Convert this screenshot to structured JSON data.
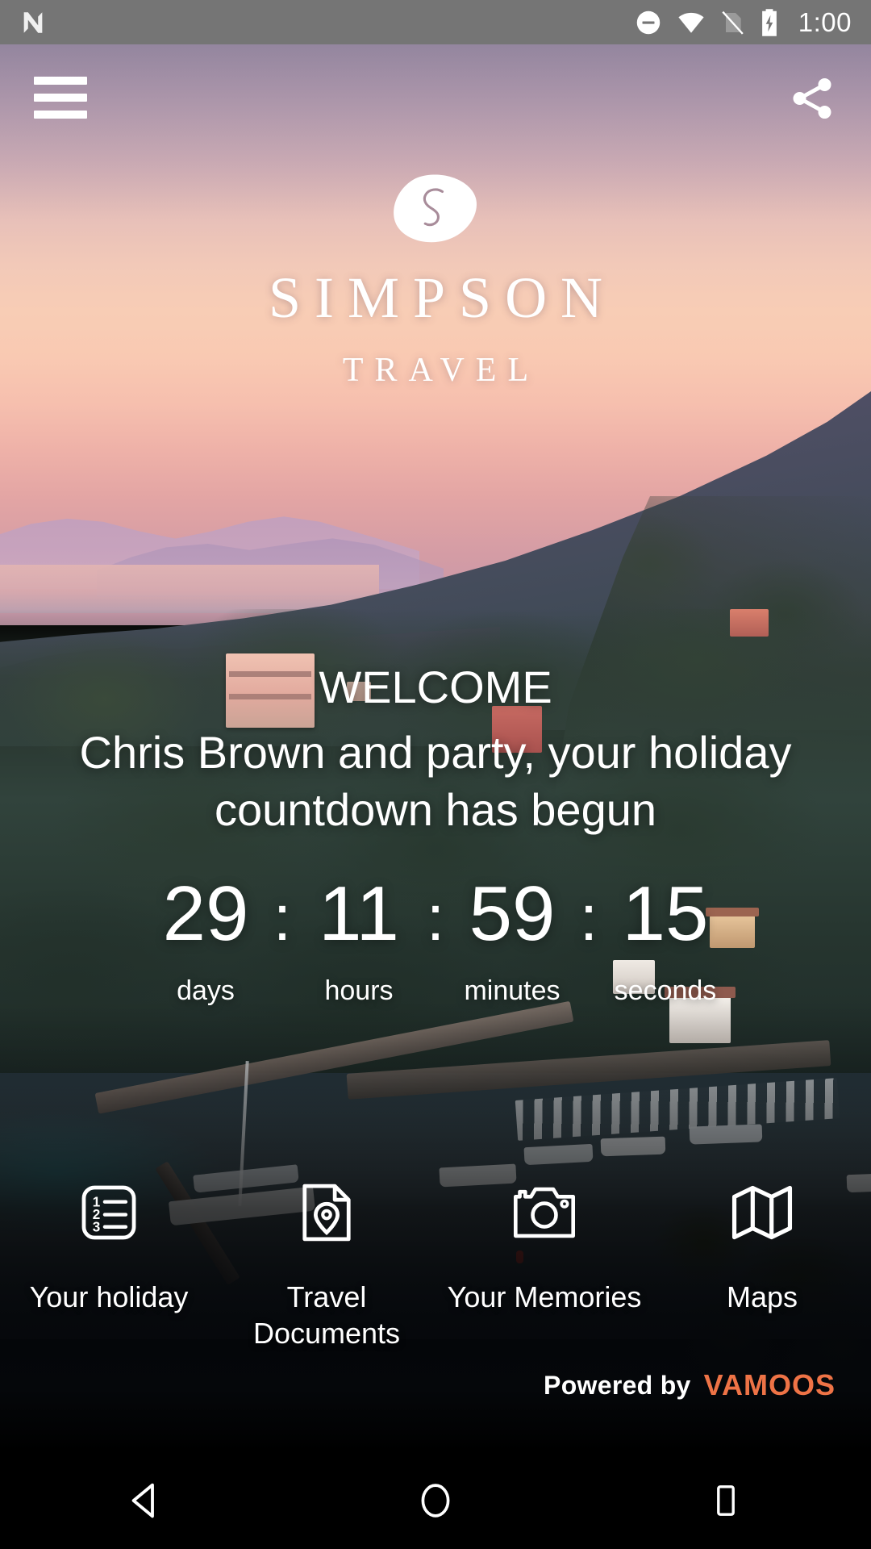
{
  "statusbar": {
    "app_indicator_icon": "android-n-logo-icon",
    "icons": [
      "do-not-disturb-icon",
      "wifi-icon",
      "no-sim-icon",
      "battery-charging-icon"
    ],
    "time": "1:00"
  },
  "header": {
    "menu_icon": "hamburger-menu-icon",
    "share_icon": "share-icon"
  },
  "brand": {
    "logo_icon": "simpson-pebble-logo-icon",
    "name": "SIMPSON",
    "sub": "TRAVEL"
  },
  "welcome": {
    "title": "WELCOME",
    "message": "Chris Brown and party, your holiday countdown has begun"
  },
  "countdown": {
    "separator": ":",
    "units": [
      {
        "value": "29",
        "label": "days"
      },
      {
        "value": "11",
        "label": "hours"
      },
      {
        "value": "59",
        "label": "minutes"
      },
      {
        "value": "15",
        "label": "seconds"
      }
    ]
  },
  "tiles": [
    {
      "label": "Your holiday",
      "icon": "numbered-list-icon"
    },
    {
      "label": "Travel\nDocuments",
      "icon": "document-location-pin-icon"
    },
    {
      "label": "Your Memories",
      "icon": "camera-icon"
    },
    {
      "label": "Maps",
      "icon": "folded-map-icon"
    }
  ],
  "footer": {
    "powered_text": "Powered by",
    "brand": "VAMOOS",
    "brand_color": "#ee7346"
  },
  "navbar": {
    "back_icon": "back-triangle-icon",
    "home_icon": "home-circle-icon",
    "recents_icon": "recents-square-icon"
  },
  "theme": {
    "status_bar_bg": "#757575",
    "accent": "#ee7346",
    "text_on_photo": "#ffffff"
  }
}
